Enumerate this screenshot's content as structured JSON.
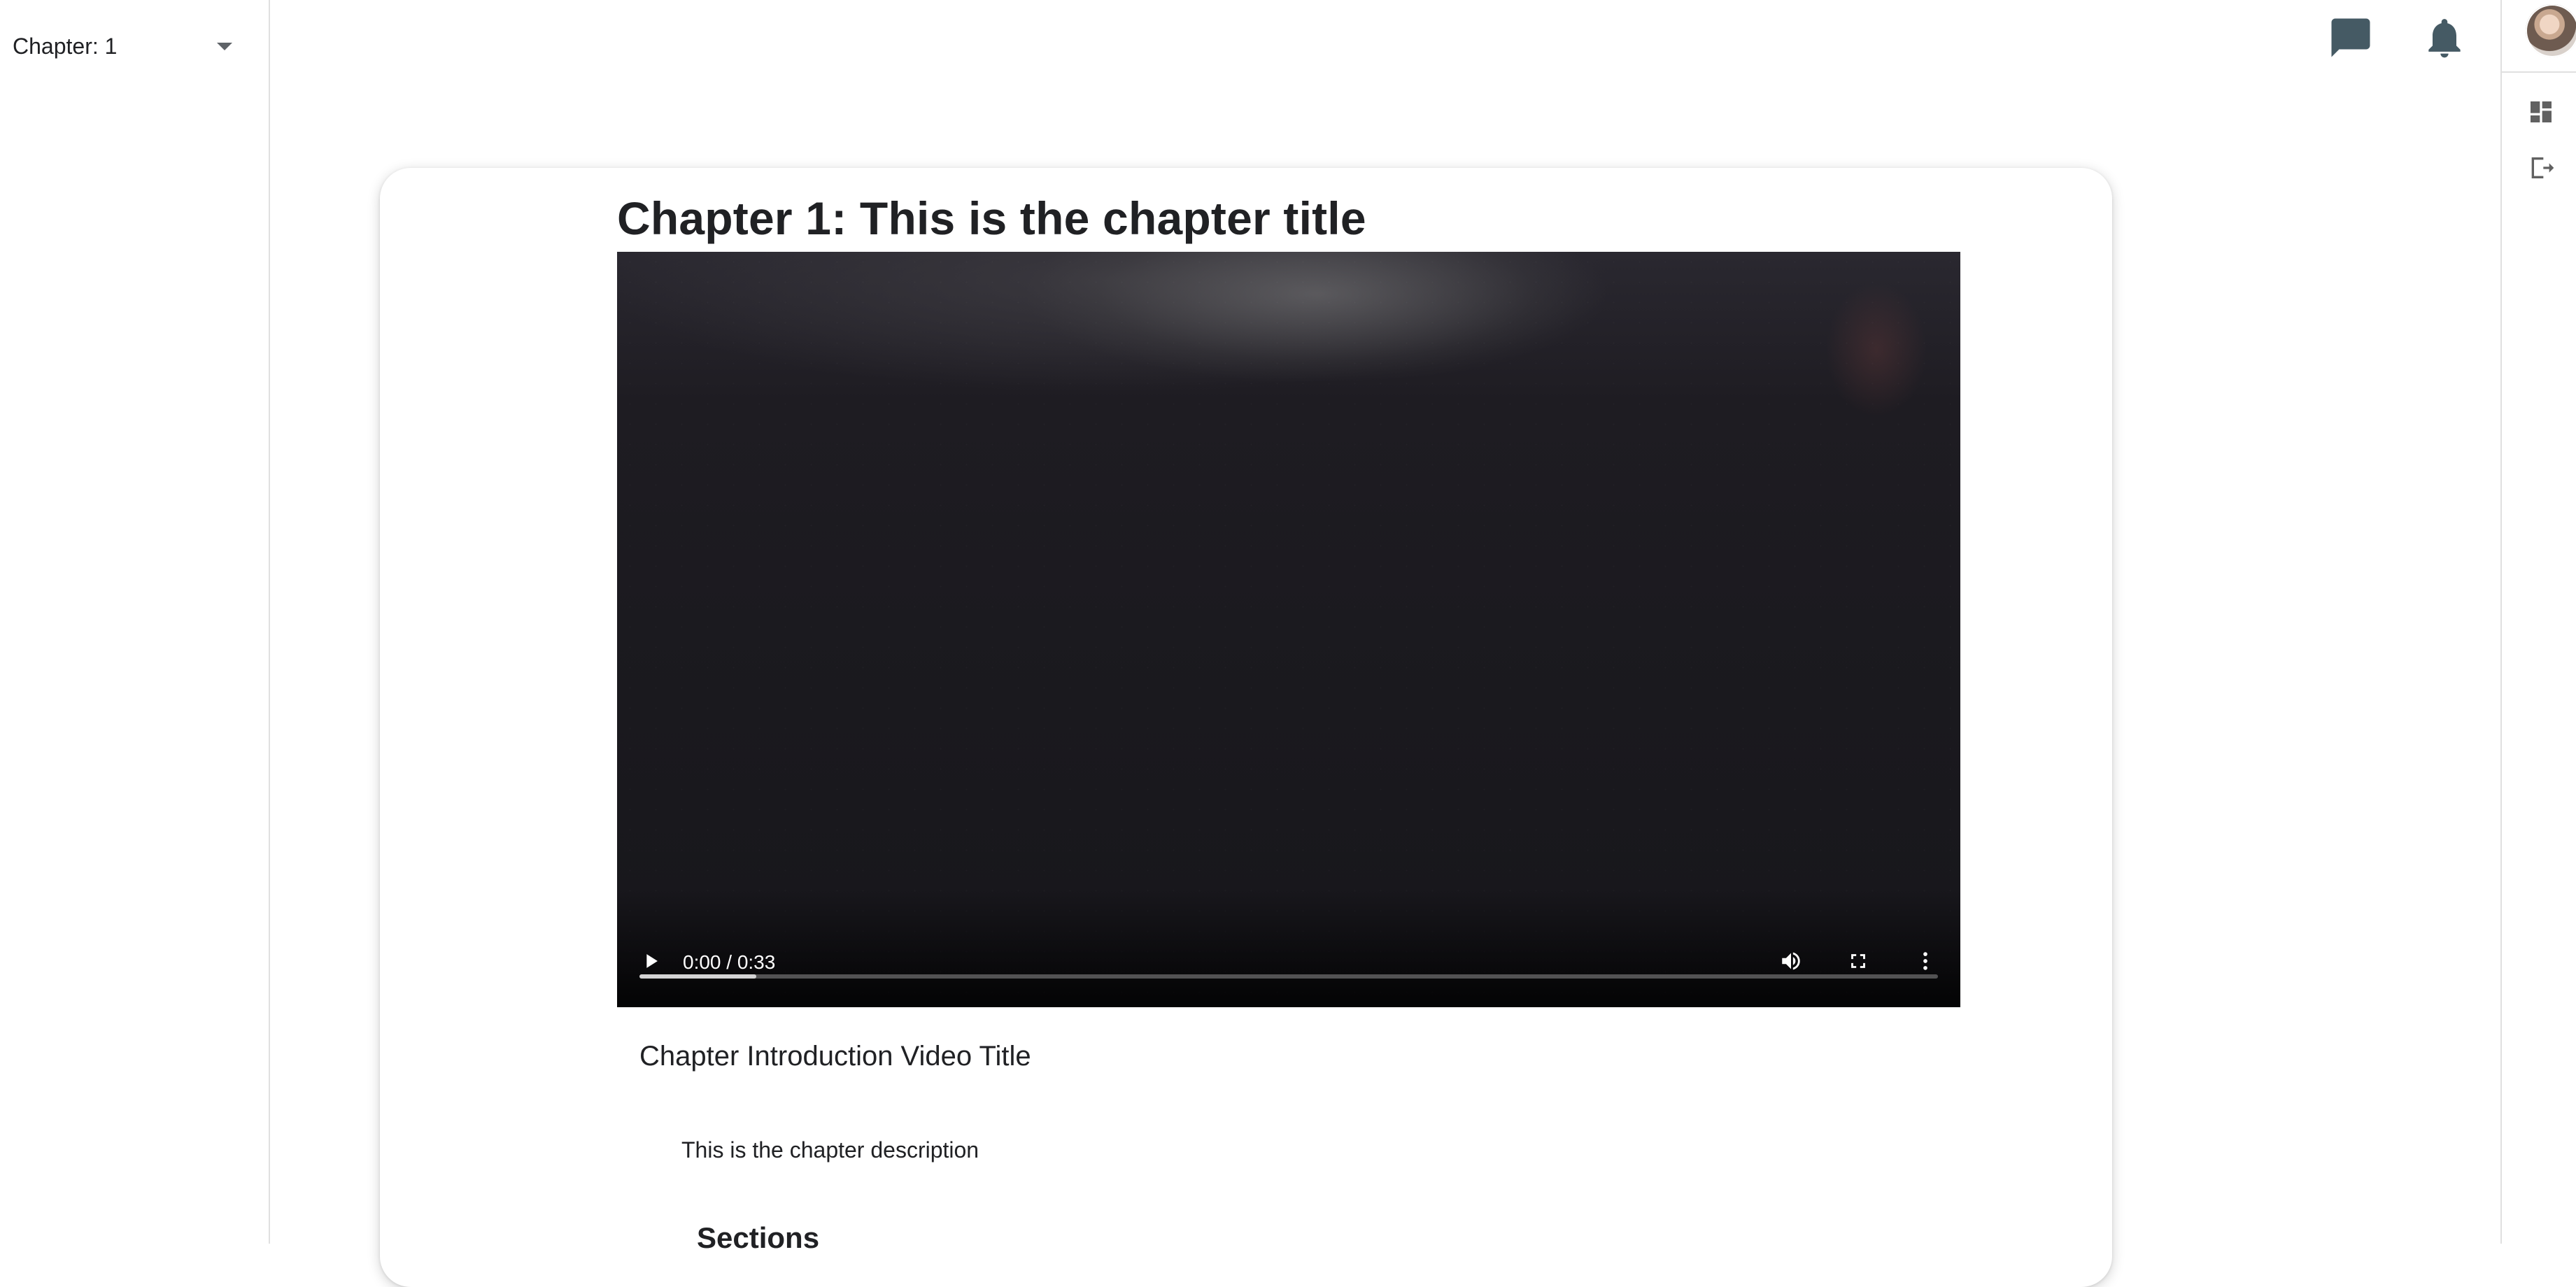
{
  "sidebar": {
    "chapter_selector_label": "Chapter: 1"
  },
  "header": {
    "icons": [
      "chat-icon",
      "notification-bell-icon"
    ]
  },
  "right_rail": {
    "icons": [
      "dashboard-icon",
      "logout-icon"
    ]
  },
  "chapter": {
    "title": "Chapter 1: This is the chapter title",
    "video_title": "Chapter Introduction Video Title",
    "description": "This is the chapter description",
    "sections_heading": "Sections"
  },
  "video": {
    "time_display": "0:00 / 0:33",
    "current_time": "0:00",
    "duration": "0:33",
    "buffered_fraction": 0.09
  },
  "colors": {
    "icon_color": "#455a64",
    "divider": "#e0e0e0"
  }
}
